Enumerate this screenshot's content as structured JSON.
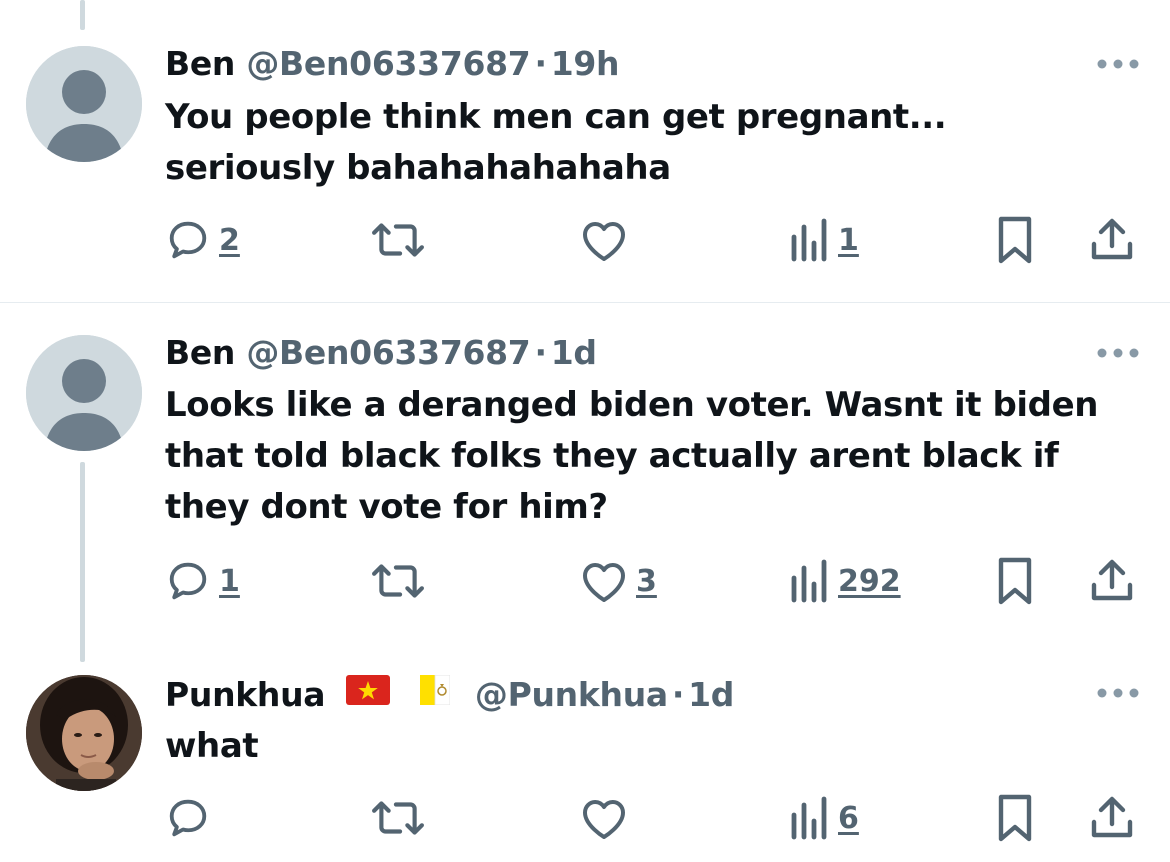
{
  "tweets": [
    {
      "display_name": "Ben",
      "handle": "@Ben06337687",
      "separator": "·",
      "time": "19h",
      "text_lines": [
        "You people think men can get pregnant...",
        "seriously bahahahahahaha"
      ],
      "avatar": "default-avatar",
      "metrics": {
        "replies": "2",
        "retweets": "",
        "likes": "",
        "views": "1"
      }
    },
    {
      "display_name": "Ben",
      "handle": "@Ben06337687",
      "separator": "·",
      "time": "1d",
      "text_lines": [
        "Looks like a deranged biden voter. Wasnt it biden",
        "that told black folks they actually arent black if",
        "they dont vote for him?"
      ],
      "avatar": "default-avatar",
      "metrics": {
        "replies": "1",
        "retweets": "",
        "likes": "3",
        "views": "292"
      }
    },
    {
      "display_name": "Punkhua",
      "handle": "@Punkhua",
      "separator": "·",
      "time": "1d",
      "flags": [
        "vietnam-flag",
        "vatican-flag"
      ],
      "text_lines": [
        "what"
      ],
      "avatar": "user-photo-avatar",
      "metrics": {
        "replies": "",
        "retweets": "",
        "likes": "",
        "views": "6"
      }
    }
  ],
  "colors": {
    "text": "#0f1419",
    "secondary": "#536471",
    "thread_line": "#cfd9de",
    "divider": "#e6ecf0",
    "flag_red": "#da251d",
    "flag_yellow": "#ffd900"
  }
}
